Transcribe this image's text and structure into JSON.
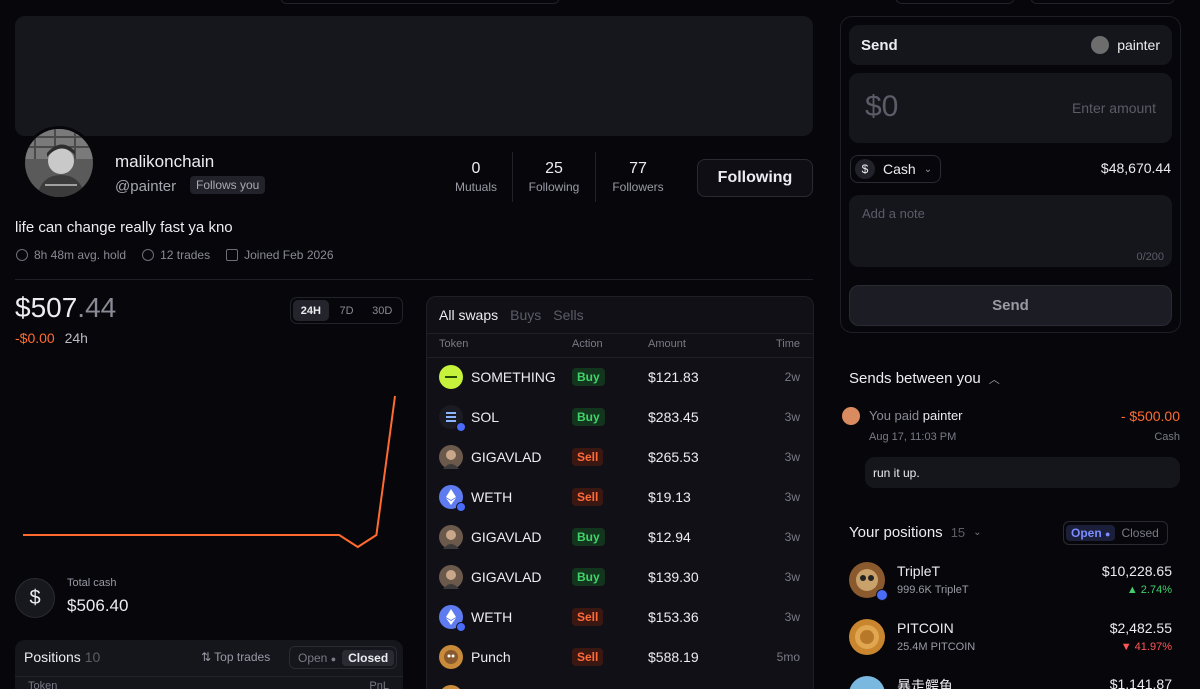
{
  "profile": {
    "display_name": "malikonchain",
    "handle": "@painter",
    "follows_you": "Follows you",
    "bio": "life can change really fast ya kno",
    "meta": {
      "avg_hold": "8h 48m avg. hold",
      "trades": "12 trades",
      "joined": "Joined Feb 2026"
    },
    "stats": [
      {
        "value": "0",
        "label": "Mutuals"
      },
      {
        "value": "25",
        "label": "Following"
      },
      {
        "value": "77",
        "label": "Followers"
      }
    ],
    "follow_button": "Following"
  },
  "portfolio": {
    "value_main": "$507",
    "value_cents": ".44",
    "change": "-$0.00",
    "change_period": "24h",
    "ranges": [
      "24H",
      "7D",
      "30D"
    ],
    "active_range": "24H",
    "total_cash_label": "Total cash",
    "total_cash": "$506.40",
    "accent": "#ff6a2f",
    "chart_data": {
      "type": "line",
      "x": [
        0,
        1,
        2,
        3,
        4,
        5,
        6,
        7,
        8,
        9,
        10,
        11,
        12,
        13,
        14,
        15,
        16,
        17,
        18,
        19,
        20
      ],
      "values": [
        507.4,
        507.4,
        507.4,
        507.4,
        507.4,
        507.4,
        507.4,
        507.4,
        507.4,
        507.4,
        507.4,
        507.4,
        507.4,
        507.4,
        507.4,
        507.4,
        507.4,
        507.4,
        507.1,
        507.4,
        507.44
      ],
      "grid": false
    }
  },
  "positions_bottom": {
    "title": "Positions",
    "count": "10",
    "top_trades": "Top trades",
    "open": "Open",
    "closed": "Closed",
    "col_token": "Token",
    "col_pnl": "PnL"
  },
  "swaps": {
    "tabs": [
      "All swaps",
      "Buys",
      "Sells"
    ],
    "headers": [
      "Token",
      "Action",
      "Amount",
      "Time"
    ],
    "rows": [
      {
        "token": "SOMETHING",
        "action": "Buy",
        "amount": "$121.83",
        "time": "2w",
        "icon": "something-token-icon",
        "color": "#c6f23b"
      },
      {
        "token": "SOL",
        "action": "Buy",
        "amount": "$283.45",
        "time": "3w",
        "icon": "solana-icon",
        "color": "#1b1b24"
      },
      {
        "token": "GIGAVLAD",
        "action": "Sell",
        "amount": "$265.53",
        "time": "3w",
        "icon": "gigavlad-avatar-icon",
        "color": "#6b5a4c"
      },
      {
        "token": "WETH",
        "action": "Sell",
        "amount": "$19.13",
        "time": "3w",
        "icon": "ethereum-icon",
        "color": "#5e7cf0"
      },
      {
        "token": "GIGAVLAD",
        "action": "Buy",
        "amount": "$12.94",
        "time": "3w",
        "icon": "gigavlad-avatar-icon",
        "color": "#6b5a4c"
      },
      {
        "token": "GIGAVLAD",
        "action": "Buy",
        "amount": "$139.30",
        "time": "3w",
        "icon": "gigavlad-avatar-icon",
        "color": "#6b5a4c"
      },
      {
        "token": "WETH",
        "action": "Sell",
        "amount": "$153.36",
        "time": "3w",
        "icon": "ethereum-icon",
        "color": "#5e7cf0"
      },
      {
        "token": "Punch",
        "action": "Sell",
        "amount": "$588.19",
        "time": "5mo",
        "icon": "punch-token-icon",
        "color": "#c98a3a"
      }
    ]
  },
  "send": {
    "title": "Send",
    "recipient": "painter",
    "amount_value": "$0",
    "amount_placeholder": "Enter amount",
    "currency": "Cash",
    "currency_symbol": "$",
    "balance": "$48,670.44",
    "note_placeholder": "Add a note",
    "note_count": "0/200",
    "send_button": "Send"
  },
  "sends_between": {
    "title": "Sends between you",
    "entry": {
      "prefix": "You paid",
      "name": "painter",
      "amount": "- $500.00",
      "date": "Aug 17, 11:03 PM",
      "method": "Cash",
      "message": "run it up."
    }
  },
  "your_positions": {
    "title": "Your positions",
    "count": "15",
    "open": "Open",
    "closed": "Closed",
    "items": [
      {
        "name": "TripleT",
        "amount": "999.6K TripleT",
        "value": "$10,228.65",
        "change": "▲ 2.74%",
        "dir": "up",
        "icon": "triplet-token-icon",
        "color": "#8a5a2e"
      },
      {
        "name": "PITCOIN",
        "amount": "25.4M PITCOIN",
        "value": "$2,482.55",
        "change": "▼ 41.97%",
        "dir": "down",
        "icon": "pitcoin-token-icon",
        "color": "#c9862f"
      },
      {
        "name": "暴走鳄鱼",
        "amount": "",
        "value": "$1,141.87",
        "change": "",
        "dir": "up",
        "icon": "crocodile-token-icon",
        "color": "#7ab8e0"
      }
    ]
  }
}
